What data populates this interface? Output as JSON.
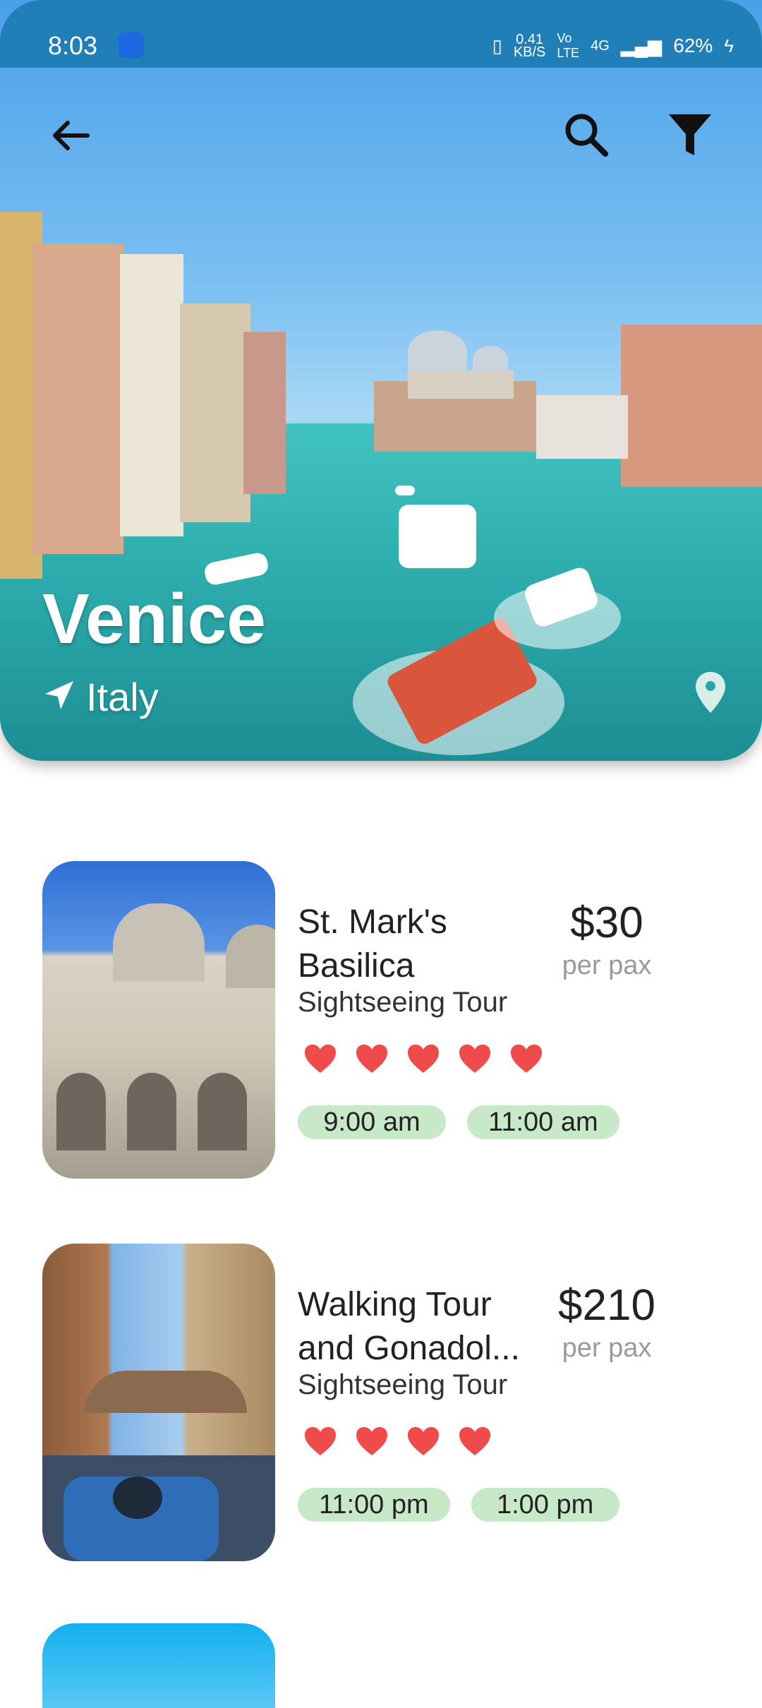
{
  "status": {
    "time": "8:03",
    "speed": "0.41",
    "speed_unit": "KB/S",
    "network": "4G",
    "battery": "62%"
  },
  "topbar": {
    "back_icon": "arrow-left-icon",
    "search_icon": "search-icon",
    "filter_icon": "filter-icon"
  },
  "hero": {
    "title": "Venice",
    "country": "Italy"
  },
  "tours": [
    {
      "name_line1": "St. Mark's",
      "name_line2": "Basilica",
      "type": "Sightseeing Tour",
      "price": "$30",
      "unit": "per pax",
      "rating": 5,
      "times": [
        "9:00 am",
        "11:00 am"
      ]
    },
    {
      "name_line1": "Walking Tour",
      "name_line2": "and Gonadol...",
      "type": "Sightseeing Tour",
      "price": "$210",
      "unit": "per pax",
      "rating": 4,
      "times": [
        "11:00 pm",
        "1:00 pm"
      ]
    }
  ],
  "colors": {
    "chip": "#c7e9c8",
    "heart": "#ef4b4b",
    "status_bar": "#1f7fb6"
  }
}
